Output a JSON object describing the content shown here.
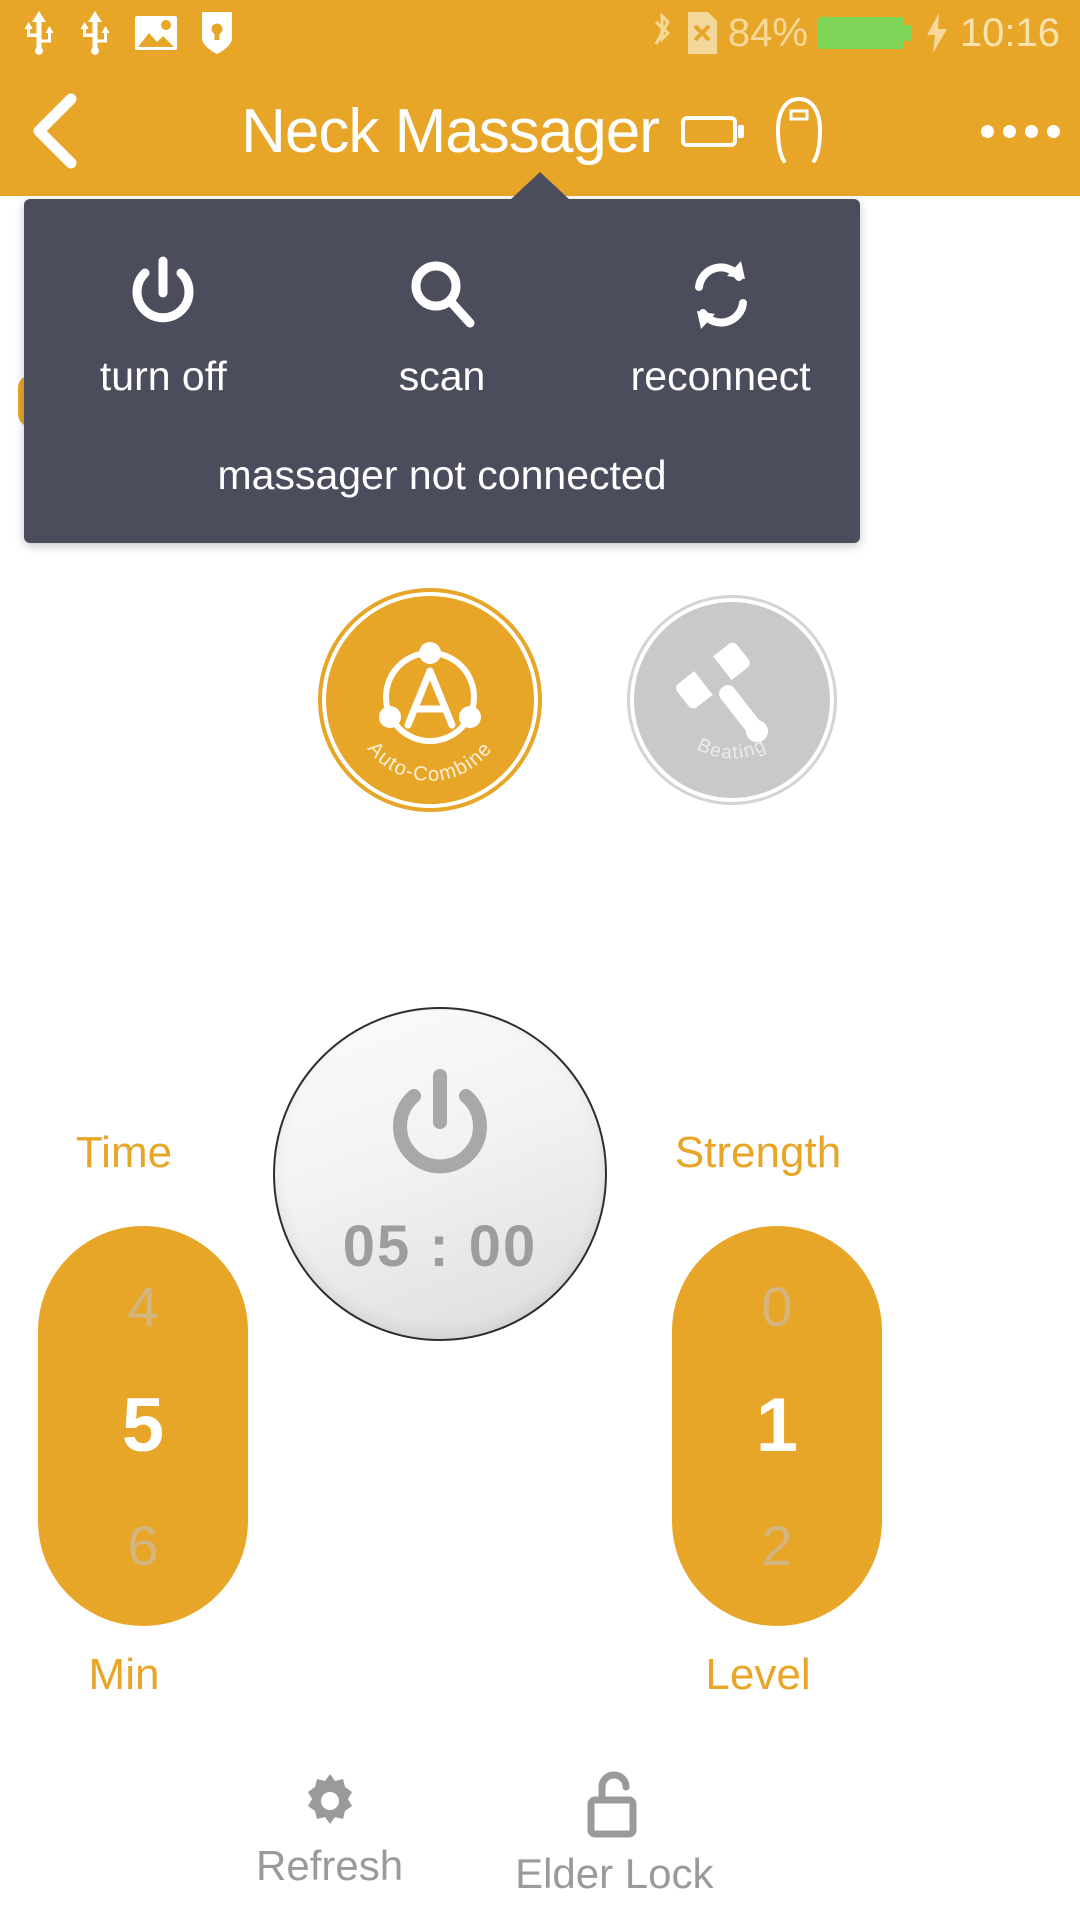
{
  "statusbar": {
    "icons": [
      "usb-icon",
      "usb-icon",
      "gallery-icon",
      "shield-lock-icon",
      "bluetooth-icon",
      "sim-card-off-icon"
    ],
    "battery_percent": "84%",
    "charging": true,
    "clock": "10:16"
  },
  "titlebar": {
    "back_label": "back-chevron",
    "title": "Neck Massager",
    "battery_icon_name": "device-battery-icon",
    "device_icon_name": "neck-massager-icon",
    "more_label": "more-options"
  },
  "panel": {
    "actions": [
      {
        "icon": "power-icon",
        "label": "turn off"
      },
      {
        "icon": "search-icon",
        "label": "scan"
      },
      {
        "icon": "reconnect-icon",
        "label": "reconnect"
      }
    ],
    "status": "massager not connected"
  },
  "modes": [
    {
      "name": "auto-combine",
      "label": "Auto-Combine",
      "icon": "atom-a-icon",
      "selected": true
    },
    {
      "name": "beating",
      "label": "Beating",
      "icon": "hammer-icon",
      "selected": false
    }
  ],
  "time_picker": {
    "title": "Time",
    "unit": "Min",
    "values": [
      "4",
      "5",
      "6"
    ],
    "selected_index": 1
  },
  "strength_picker": {
    "title": "Strength",
    "unit": "Level",
    "values": [
      "0",
      "1",
      "2"
    ],
    "selected_index": 1
  },
  "power_button": {
    "icon": "power-icon",
    "countdown": "05 : 00"
  },
  "bottombar": [
    {
      "name": "refresh",
      "icon": "gear-icon",
      "label": "Refresh"
    },
    {
      "name": "elder-lock",
      "icon": "lock-open-icon",
      "label": "Elder Lock"
    }
  ],
  "colors": {
    "accent": "#e8a628",
    "panel": "#4b4c5c",
    "inactive": "#c9c9c9",
    "muted_text": "#9a9a9a"
  }
}
